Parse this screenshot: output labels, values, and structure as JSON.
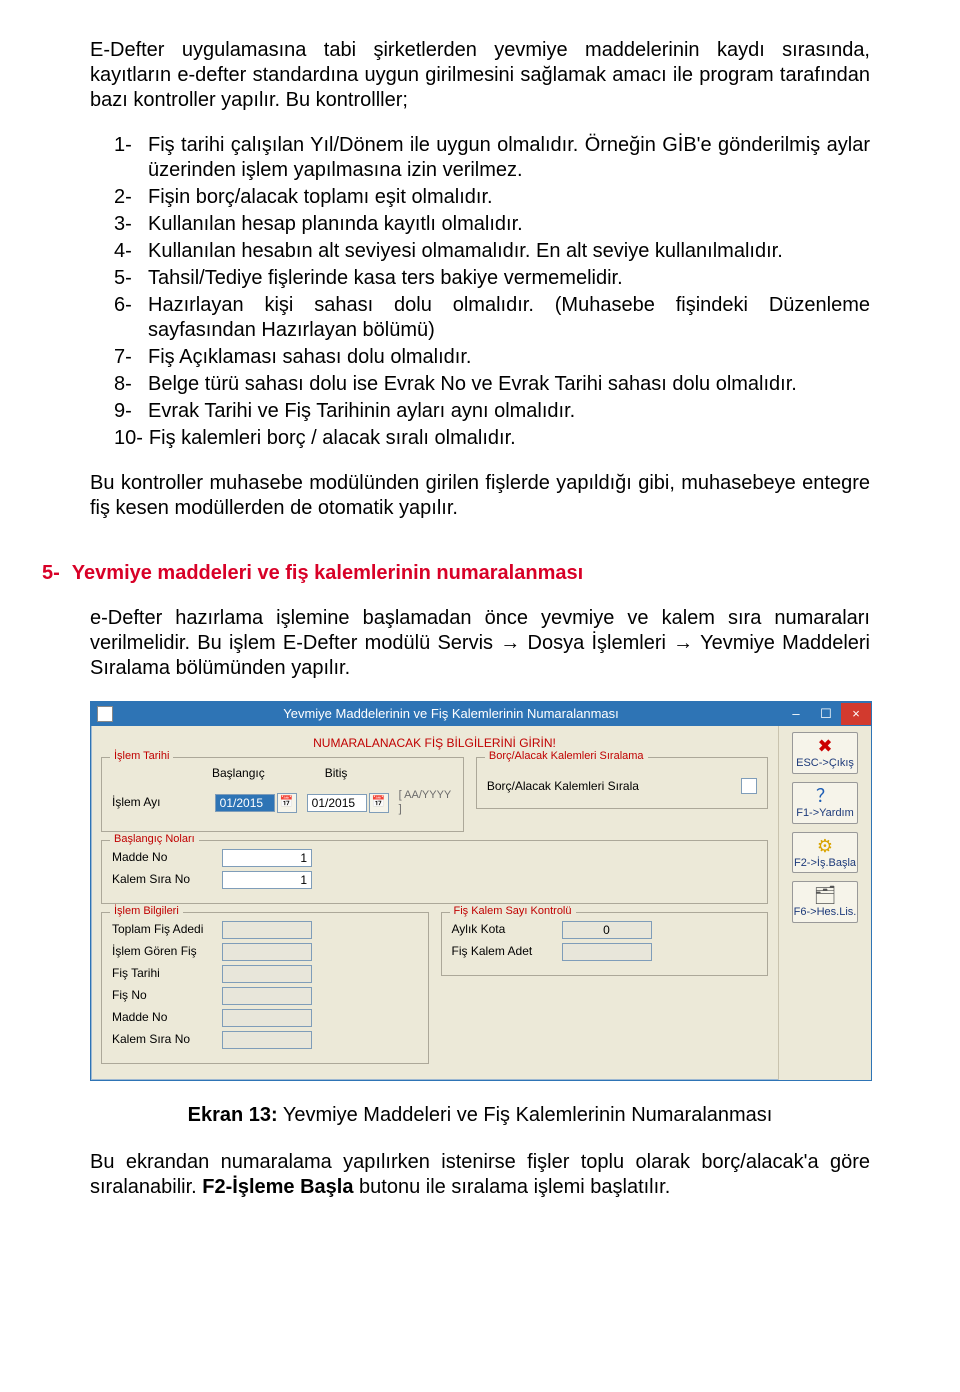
{
  "doc": {
    "intro": "E-Defter uygulamasına tabi şirketlerden yevmiye maddelerinin kaydı sırasında, kayıtların e-defter standardına uygun girilmesini sağlamak amacı ile program tarafından bazı kontroller yapılır. Bu kontrolller;",
    "list": {
      "i1": "Fiş tarihi çalışılan Yıl/Dönem ile uygun olmalıdır. Örneğin GİB'e gönderilmiş aylar üzerinden işlem yapılmasına izin verilmez.",
      "i2": "Fişin borç/alacak toplamı eşit olmalıdır.",
      "i3": "Kullanılan hesap planında kayıtlı olmalıdır.",
      "i4": "Kullanılan hesabın alt seviyesi olmamalıdır. En alt seviye kullanılmalıdır.",
      "i5": "Tahsil/Tediye fişlerinde kasa ters bakiye vermemelidir.",
      "i6": "Hazırlayan kişi sahası dolu olmalıdır. (Muhasebe fişindeki Düzenleme sayfasından Hazırlayan bölümü)",
      "i7": "Fiş Açıklaması sahası dolu olmalıdır.",
      "i8": "Belge türü sahası dolu ise Evrak No ve Evrak Tarihi sahası dolu olmalıdır.",
      "i9": "Evrak Tarihi ve Fiş Tarihinin ayları aynı olmalıdır.",
      "i10": "Fiş kalemleri borç / alacak sıralı olmalıdır."
    },
    "after_list": "Bu kontroller muhasebe modülünden girilen fişlerde yapıldığı gibi, muhasebeye entegre fiş kesen modüllerden de otomatik yapılır.",
    "section5_num": "5-",
    "section5_title": "Yevmiye maddeleri ve fiş kalemlerinin numaralanması",
    "section5_p": "e-Defter hazırlama işlemine başlamadan önce yevmiye ve kalem sıra numaraları verilmelidir. Bu işlem E-Defter modülü Servis → Dosya İşlemleri → Yevmiye Maddeleri Sıralama bölümünden yapılır.",
    "caption_label": "Ekran 13:",
    "caption_text": " Yevmiye Maddeleri ve Fiş Kalemlerinin Numaralanması",
    "bottom_p_1": "Bu ekrandan numaralama yapılırken istenirse fişler toplu olarak borç/alacak'a göre sıralanabilir.  ",
    "bottom_bold": "F2-İşleme Başla",
    "bottom_p_2": " butonu ile sıralama işlemi başlatılır."
  },
  "app": {
    "title": "Yevmiye Maddelerinin ve Fiş Kalemlerinin Numaralanması",
    "header_red": "NUMARALANACAK FİŞ BİLGİLERİNİ GİRİN!",
    "groups": {
      "islem_tarihi": "İşlem Tarihi",
      "baslangic_nolari": "Başlangıç Noları",
      "islem_bilgileri": "İşlem Bilgileri",
      "borc_alacak": "Borç/Alacak Kalemleri Sıralama",
      "fis_kalem_sayi": "Fiş Kalem Sayı Kontrolü"
    },
    "labels": {
      "baslangic": "Başlangıç",
      "bitis": "Bitiş",
      "islem_ayi": "İşlem Ayı",
      "aa_yyyy": "[ AA/YYYY ]",
      "madde_no": "Madde No",
      "kalem_sira_no": "Kalem Sıra No",
      "toplam_fis_adedi": "Toplam Fiş Adedi",
      "islem_goren_fis": "İşlem Gören Fiş",
      "fis_tarihi": "Fiş Tarihi",
      "fis_no": "Fiş No",
      "madde_no2": "Madde No",
      "kalem_sira_no2": "Kalem Sıra No",
      "borc_alacak_sirala": "Borç/Alacak Kalemleri Sırala",
      "aylik_kota": "Aylık Kota",
      "fis_kalem_adet": "Fiş Kalem Adet"
    },
    "values": {
      "baslangic": "01/2015",
      "bitis": "01/2015",
      "madde_no": "1",
      "kalem_sira_no": "1",
      "aylik_kota": "0"
    },
    "buttons": {
      "esc": "ESC->Çıkış",
      "f1": "F1->Yardım",
      "f2": "F2->İş.Başla",
      "f6": "F6->Hes.Lis."
    },
    "win": {
      "min": "–",
      "max": "☐",
      "close": "×"
    }
  }
}
